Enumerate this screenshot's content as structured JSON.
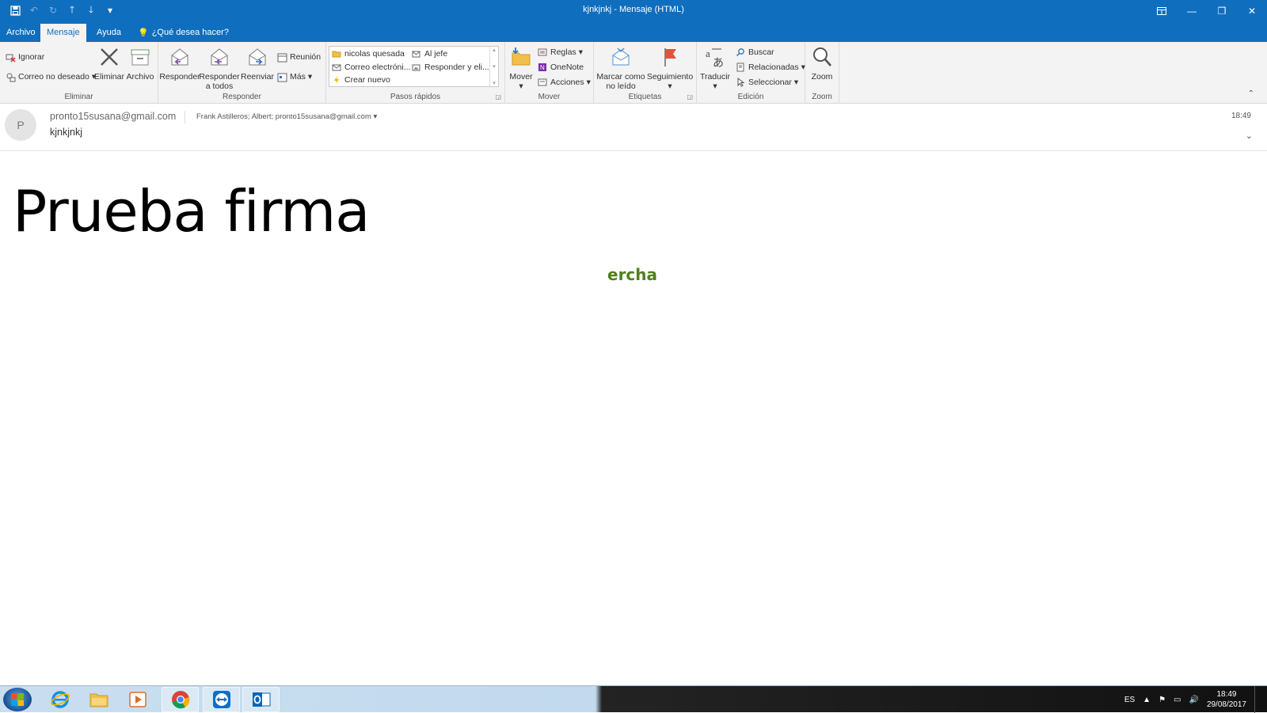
{
  "window": {
    "title": "kjnkjnkj  -  Mensaje (HTML)"
  },
  "tabs": [
    {
      "label": "Archivo"
    },
    {
      "label": "Mensaje"
    },
    {
      "label": "Ayuda"
    }
  ],
  "tell_me": "¿Qué desea hacer?",
  "ribbon": {
    "eliminar": {
      "label": "Eliminar",
      "ignorar": "Ignorar",
      "correo_no_deseado": "Correo no deseado",
      "eliminar": "Eliminar",
      "archivo": "Archivo"
    },
    "responder": {
      "label": "Responder",
      "responder": "Responder",
      "responder_todos_1": "Responder",
      "responder_todos_2": "a todos",
      "reenviar": "Reenviar",
      "reunion": "Reunión",
      "mas": "Más"
    },
    "pasos_rapidos": {
      "label": "Pasos rápidos",
      "items": [
        "nicolas quesada",
        "Al jefe",
        "Correo electróni...",
        "Responder y eli...",
        "Crear nuevo"
      ]
    },
    "mover": {
      "label": "Mover",
      "mover": "Mover",
      "reglas": "Reglas",
      "onenote": "OneNote",
      "acciones": "Acciones"
    },
    "etiquetas": {
      "label": "Etiquetas",
      "marcar_1": "Marcar como",
      "marcar_2": "no leído",
      "seguimiento": "Seguimiento"
    },
    "edicion": {
      "label": "Edición",
      "traducir": "Traducir",
      "buscar": "Buscar",
      "relacionadas": "Relacionadas",
      "seleccionar": "Seleccionar"
    },
    "zoom": {
      "label": "Zoom",
      "zoom": "Zoom"
    }
  },
  "message": {
    "avatar_letter": "P",
    "sender": "pronto15susana@gmail.com",
    "recipients": "Frank Astilleros; Albert; pronto15susana@gmail.com",
    "subject": "kjnkjnkj",
    "time": "18:49",
    "body_heading": "Prueba firma",
    "body_green": "ercha"
  },
  "taskbar": {
    "language": "ES",
    "clock_time": "18:49",
    "clock_date": "29/08/2017"
  },
  "colors": {
    "titlebar": "#106ebe",
    "ribbon": "#f3f3f3",
    "green_text": "#4f7f1f"
  }
}
